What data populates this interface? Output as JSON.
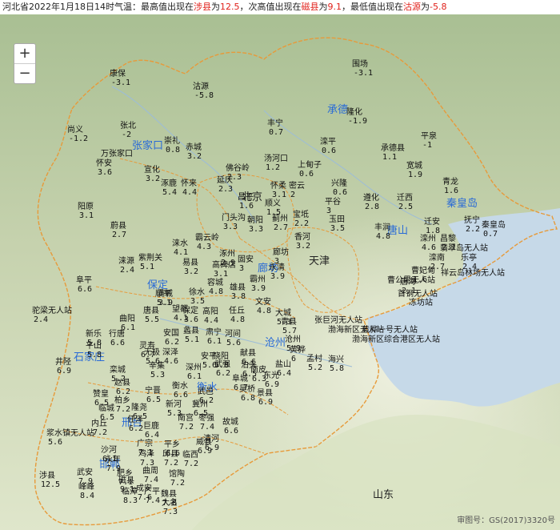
{
  "header": {
    "prefix": "河北省2022年1月18日14时气温：最高值出现在",
    "max_station": "涉县",
    "mid1": "为",
    "max_value": "12.5",
    "mid2": "，次高值出现在",
    "second_station": "磁县",
    "mid3": "为",
    "second_value": "9.1",
    "mid4": "，最低值出现在",
    "min_station": "沽源",
    "mid5": "为",
    "min_value": "-5.8"
  },
  "zoom": {
    "in": "+",
    "out": "−"
  },
  "regions": [
    "天津",
    "北京",
    "山东"
  ],
  "cities": [
    "承德",
    "张家口",
    "秦皇岛",
    "唐山",
    "廊坊",
    "保定",
    "沧州",
    "石家庄",
    "衡水",
    "邢台",
    "邯郸"
  ],
  "stations": [
    {
      "n": "康保",
      "t": "-3.1"
    },
    {
      "n": "沽源",
      "t": "-5.8"
    },
    {
      "n": "围场",
      "t": "-3.1"
    },
    {
      "n": "尚义",
      "t": "-1.2"
    },
    {
      "n": "张北",
      "t": "-2"
    },
    {
      "n": "丰宁",
      "t": "0.7"
    },
    {
      "n": "承德",
      "t": ""
    },
    {
      "n": "隆化",
      "t": "-1.9"
    },
    {
      "n": "平泉",
      "t": "-1"
    },
    {
      "n": "崇礼",
      "t": "0.8"
    },
    {
      "n": "万张家口",
      "t": ""
    },
    {
      "n": "赤城",
      "t": "3.2"
    },
    {
      "n": "滦平",
      "t": "0.6"
    },
    {
      "n": "承德县",
      "t": "1.1"
    },
    {
      "n": "宽城",
      "t": "1.9"
    },
    {
      "n": "怀安",
      "t": "3.6"
    },
    {
      "n": "宣化",
      "t": "3.2"
    },
    {
      "n": "涿鹿",
      "t": "5.4"
    },
    {
      "n": "怀来",
      "t": "4.4"
    },
    {
      "n": "佛谷岭",
      "t": "2.3"
    },
    {
      "n": "汤河口",
      "t": "1.2"
    },
    {
      "n": "上甸子",
      "t": "0.6"
    },
    {
      "n": "兴隆",
      "t": "0.6"
    },
    {
      "n": "青龙",
      "t": "1.6"
    },
    {
      "n": "阳原",
      "t": "3.1"
    },
    {
      "n": "延庆",
      "t": "2.3"
    },
    {
      "n": "怀柔",
      "t": "3.1"
    },
    {
      "n": "密云",
      "t": "2"
    },
    {
      "n": "平谷",
      "t": "3"
    },
    {
      "n": "遵化",
      "t": "2.8"
    },
    {
      "n": "迁西",
      "t": "2.5"
    },
    {
      "n": "蔚县",
      "t": "2.7"
    },
    {
      "n": "昌平",
      "t": "1.6"
    },
    {
      "n": "顺义",
      "t": "1.5"
    },
    {
      "n": "蓟州",
      "t": "2.7"
    },
    {
      "n": "玉田",
      "t": "3.5"
    },
    {
      "n": "丰润",
      "t": "4.8"
    },
    {
      "n": "迁安",
      "t": "1.8"
    },
    {
      "n": "抚宁",
      "t": "2.2"
    },
    {
      "n": "秦皇岛",
      "t": "0.7"
    },
    {
      "n": "涞源",
      "t": "2.4"
    },
    {
      "n": "紫荆关",
      "t": "5.1"
    },
    {
      "n": "涞水",
      "t": "4.1"
    },
    {
      "n": "霸云岭",
      "t": "4.3"
    },
    {
      "n": "门头沟",
      "t": "3.3"
    },
    {
      "n": "朝阳",
      "t": "3.3"
    },
    {
      "n": "宝坻",
      "t": "2.2"
    },
    {
      "n": "香河",
      "t": "3.2"
    },
    {
      "n": "滦州",
      "t": "4.6"
    },
    {
      "n": "昌黎",
      "t": "2.1"
    },
    {
      "n": "易县",
      "t": "3.2"
    },
    {
      "n": "涿州",
      "t": "2.9"
    },
    {
      "n": "固安",
      "t": "3"
    },
    {
      "n": "廊坊",
      "t": "3"
    },
    {
      "n": "滦南",
      "t": "2.7"
    },
    {
      "n": "乐亭",
      "t": "2.4"
    },
    {
      "n": "阜平",
      "t": "6.6"
    },
    {
      "n": "满城",
      "t": "3.9"
    },
    {
      "n": "高碑店",
      "t": "3.1"
    },
    {
      "n": "永清",
      "t": "3.9"
    },
    {
      "n": "霸州",
      "t": "3.9"
    },
    {
      "n": "曹妃甸",
      "t": "1.6"
    },
    {
      "n": "唐海",
      "t": "2.1"
    },
    {
      "n": "驼梁无人站",
      "t": "2.4"
    },
    {
      "n": "顺平",
      "t": "5.1"
    },
    {
      "n": "徐水",
      "t": "3.5"
    },
    {
      "n": "容城",
      "t": "4.8"
    },
    {
      "n": "雄县",
      "t": "3.8"
    },
    {
      "n": "文安",
      "t": "4.8"
    },
    {
      "n": "大城",
      "t": "5.3"
    },
    {
      "n": "曲阳",
      "t": "6.1"
    },
    {
      "n": "唐县",
      "t": "5.5"
    },
    {
      "n": "望都",
      "t": "4.1"
    },
    {
      "n": "保定",
      "t": "3.6"
    },
    {
      "n": "高阳",
      "t": "4.4"
    },
    {
      "n": "任丘",
      "t": "4.8"
    },
    {
      "n": "青县",
      "t": "5.7"
    },
    {
      "n": "行唐",
      "t": "6.6"
    },
    {
      "n": "新乐",
      "t": "5.8"
    },
    {
      "n": "安国",
      "t": "6.2"
    },
    {
      "n": "蠡县",
      "t": "5.1"
    },
    {
      "n": "肃宁",
      "t": "6.1"
    },
    {
      "n": "河间",
      "t": "5.6"
    },
    {
      "n": "沧州",
      "t": "5.9"
    },
    {
      "n": "黄骅",
      "t": "6"
    },
    {
      "n": "平山",
      "t": "5.8"
    },
    {
      "n": "灵寿",
      "t": "6.7"
    },
    {
      "n": "无极",
      "t": "5.6"
    },
    {
      "n": "深泽",
      "t": "4.6"
    },
    {
      "n": "安平",
      "t": "5.6"
    },
    {
      "n": "饶阳",
      "t": "5.8"
    },
    {
      "n": "献县",
      "t": "6.6"
    },
    {
      "n": "泊头",
      "t": "6.5"
    },
    {
      "n": "海兴",
      "t": "5.8"
    },
    {
      "n": "盐山",
      "t": "6.4"
    },
    {
      "n": "孟村",
      "t": "5.2"
    },
    {
      "n": "井陉",
      "t": "6.9"
    },
    {
      "n": "石家庄",
      "t": ""
    },
    {
      "n": "栾城",
      "t": "5.2"
    },
    {
      "n": "辛集",
      "t": "5.3"
    },
    {
      "n": "深州",
      "t": "6.1"
    },
    {
      "n": "武强",
      "t": "6.2"
    },
    {
      "n": "南皮",
      "t": "6.3"
    },
    {
      "n": "东光",
      "t": "6.9"
    },
    {
      "n": "吴桥",
      "t": "6.8"
    },
    {
      "n": "赞皇",
      "t": "6.5"
    },
    {
      "n": "赵县",
      "t": "6.2"
    },
    {
      "n": "宁晋",
      "t": "6.5"
    },
    {
      "n": "衡水",
      "t": "6.6"
    },
    {
      "n": "武邑",
      "t": "6.2"
    },
    {
      "n": "阜城",
      "t": "6.7"
    },
    {
      "n": "景县",
      "t": "6.9"
    },
    {
      "n": "临城",
      "t": "6.5"
    },
    {
      "n": "柏乡",
      "t": "7.2"
    },
    {
      "n": "隆尧",
      "t": "6.5"
    },
    {
      "n": "新河",
      "t": "5.3"
    },
    {
      "n": "冀州",
      "t": "6.5"
    },
    {
      "n": "枣强",
      "t": "7.4"
    },
    {
      "n": "故城",
      "t": "6.6"
    },
    {
      "n": "内丘",
      "t": "7.2"
    },
    {
      "n": "任泽",
      "t": "6.2"
    },
    {
      "n": "南宫",
      "t": "7.2"
    },
    {
      "n": "巨鹿",
      "t": "6.4"
    },
    {
      "n": "沙河",
      "t": "6.1"
    },
    {
      "n": "浆水镇无人站",
      "t": "5.6"
    },
    {
      "n": "邢台",
      "t": ""
    },
    {
      "n": "广宗",
      "t": "7.1"
    },
    {
      "n": "平乡",
      "t": "6.6"
    },
    {
      "n": "威县",
      "t": "6.9"
    },
    {
      "n": "清河",
      "t": "6.9"
    },
    {
      "n": "永年",
      "t": "7.9"
    },
    {
      "n": "鸡泽",
      "t": "7.3"
    },
    {
      "n": "邱县",
      "t": "7.2"
    },
    {
      "n": "临西",
      "t": "7.2"
    },
    {
      "n": "曲周",
      "t": "7.4"
    },
    {
      "n": "邯郸",
      "t": ""
    },
    {
      "n": "肥乡",
      "t": "7.1"
    },
    {
      "n": "馆陶",
      "t": "7.2"
    },
    {
      "n": "涉县",
      "t": "12.5"
    },
    {
      "n": "武安",
      "t": "7.9"
    },
    {
      "n": "峰峰",
      "t": "8.4"
    },
    {
      "n": "磁县",
      "t": "9.1"
    },
    {
      "n": "临漳",
      "t": "8.3"
    },
    {
      "n": "成安",
      "t": "7.6"
    },
    {
      "n": "广平",
      "t": "7.4"
    },
    {
      "n": "魏县",
      "t": "7.8"
    },
    {
      "n": "大名",
      "t": "7.3"
    },
    {
      "n": "张巨河无人站",
      "t": ""
    },
    {
      "n": "渤海新区无人站",
      "t": ""
    },
    {
      "n": "黄骅一号无人站",
      "t": ""
    },
    {
      "n": "渤海新区综合港区无人站",
      "t": ""
    },
    {
      "n": "翡翠岛无人站",
      "t": ""
    },
    {
      "n": "祥云岛林场无人站",
      "t": ""
    },
    {
      "n": "曹公里无人站",
      "t": ""
    },
    {
      "n": "首钢无人站",
      "t": ""
    },
    {
      "n": "冻坊站",
      "t": ""
    }
  ],
  "credit": "审图号：GS(2017)3320号"
}
